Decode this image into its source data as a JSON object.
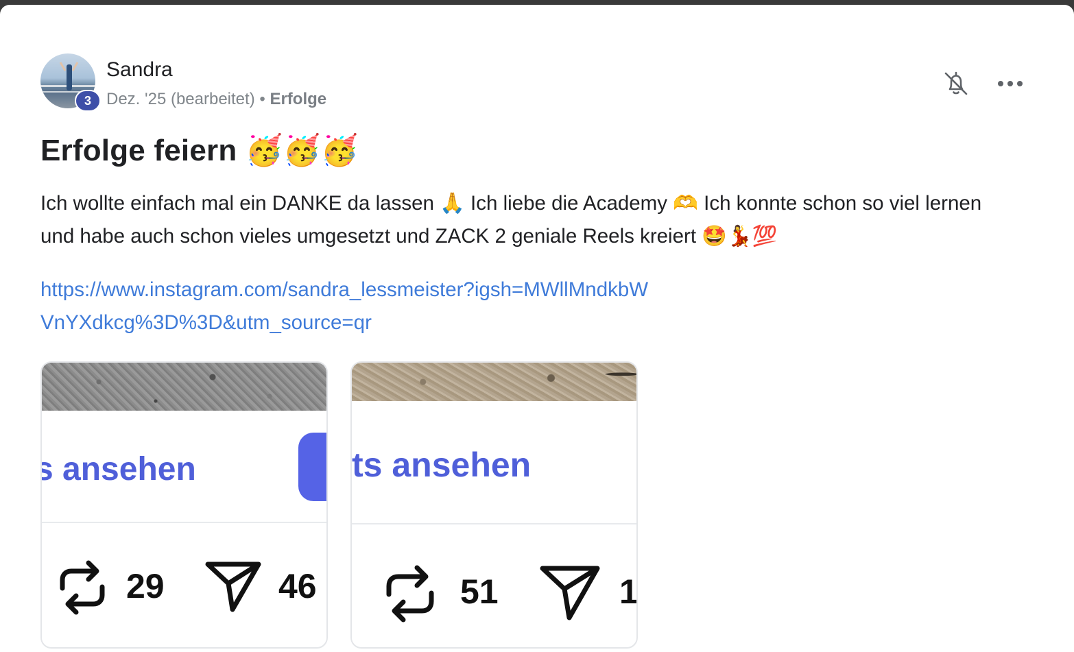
{
  "post": {
    "author": "Sandra",
    "level": "3",
    "timestamp": "Dez. '25 (bearbeitet)",
    "separator": "•",
    "category": "Erfolge",
    "title": "Erfolge feiern 🥳🥳🥳",
    "body": "Ich wollte einfach mal ein DANKE da lassen 🙏 Ich liebe die Academy 🫶 Ich konnte schon so viel lernen und habe auch schon vieles umgesetzt und ZACK 2 geniale Reels kreiert 🤩💃💯",
    "link": "https://www.instagram.com/sandra_lessmeister?igsh=MWllMndkbWVnYXdkcg%3D%3D&utm_source=qr"
  },
  "header_actions": {
    "bell_icon": "bell-off-icon",
    "more_icon": "more-horizontal-icon"
  },
  "attachments": [
    {
      "cta": "s ansehen",
      "reposts": "29",
      "shares": "46"
    },
    {
      "cta": "ts ansehen",
      "reposts": "51",
      "shares": "1"
    }
  ],
  "colors": {
    "link": "#3f7bd9",
    "accent": "#4f5fd9",
    "badge": "#3e4fa8"
  }
}
